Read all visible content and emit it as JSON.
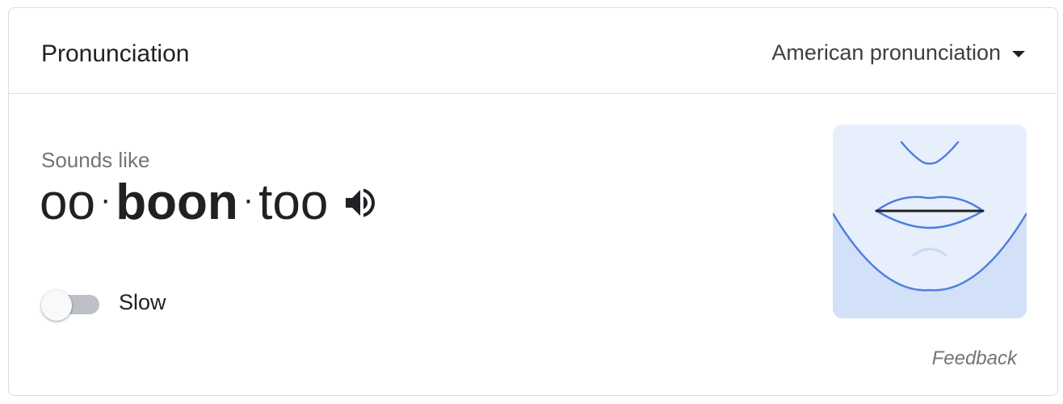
{
  "header": {
    "title": "Pronunciation",
    "accent_selected": "American pronunciation"
  },
  "sounds_like": {
    "label": "Sounds like",
    "syllables": [
      "oo",
      "boon",
      "too"
    ],
    "separator": "·",
    "stressed_index": 1
  },
  "slow_toggle": {
    "label": "Slow",
    "on": false
  },
  "feedback_label": "Feedback",
  "icons": {
    "speaker": "volume-up-icon",
    "dropdown": "caret-down-icon",
    "illustration": "mouth-illustration"
  },
  "colors": {
    "border": "#dadce0",
    "text_primary": "#202124",
    "text_secondary": "#70757a",
    "illustration_bg_top": "#e8effc",
    "illustration_bg_bottom": "#d2e0f8",
    "illustration_stroke": "#4f7fde"
  }
}
